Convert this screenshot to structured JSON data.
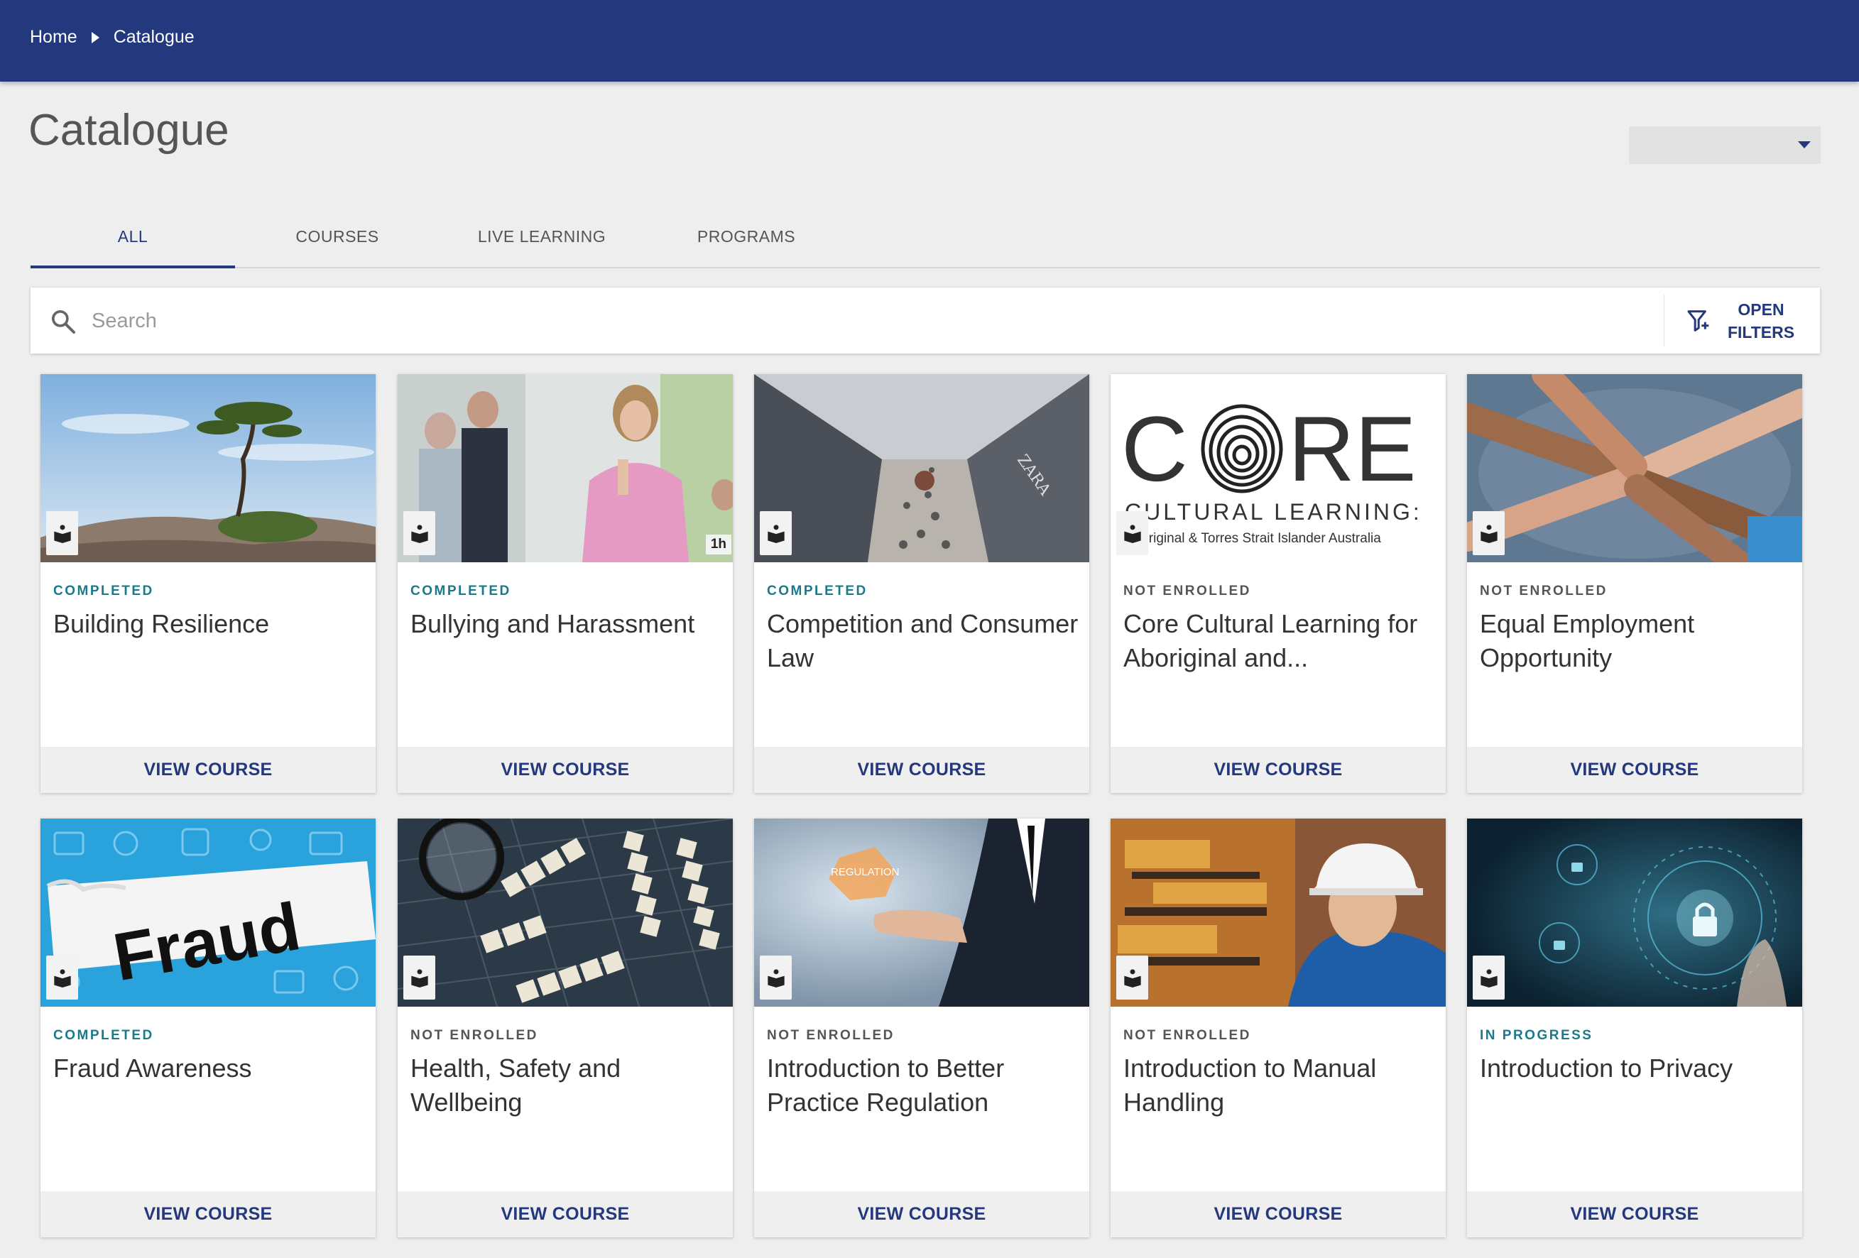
{
  "breadcrumb": {
    "home": "Home",
    "current": "Catalogue"
  },
  "page": {
    "title": "Catalogue"
  },
  "tabs": [
    {
      "label": "ALL"
    },
    {
      "label": "COURSES"
    },
    {
      "label": "LIVE LEARNING"
    },
    {
      "label": "PROGRAMS"
    }
  ],
  "search": {
    "placeholder": "Search",
    "filters_line1": "OPEN",
    "filters_line2": "FILTERS"
  },
  "colors": {
    "brand": "#24387e",
    "completed": "#1a7a8a",
    "muted": "#555555"
  },
  "cards": [
    {
      "status": "COMPLETED",
      "title": "Building Resilience",
      "action": "VIEW COURSE",
      "image": "tree-landscape",
      "duration": ""
    },
    {
      "status": "COMPLETED",
      "title": "Bullying and Harassment",
      "action": "VIEW COURSE",
      "image": "office-people",
      "duration": "1h"
    },
    {
      "status": "COMPLETED",
      "title": "Competition and Consumer Law",
      "action": "VIEW COURSE",
      "image": "shopping-mall",
      "duration": ""
    },
    {
      "status": "NOT ENROLLED",
      "title": "Core Cultural Learning for Aboriginal and...",
      "action": "VIEW COURSE",
      "image": "core-logo",
      "duration": "",
      "logo_word_left": "C",
      "logo_word_right": "RE",
      "logo_line1": "CULTURAL LEARNING:",
      "logo_line2": "Aboriginal & Torres Strait Islander Australia"
    },
    {
      "status": "NOT ENROLLED",
      "title": "Equal Employment Opportunity",
      "action": "VIEW COURSE",
      "image": "hands-stack",
      "duration": ""
    },
    {
      "status": "COMPLETED",
      "title": "Fraud Awareness",
      "action": "VIEW COURSE",
      "image": "fraud-paper",
      "duration": "",
      "image_word": "Fraud"
    },
    {
      "status": "NOT ENROLLED",
      "title": "Health, Safety and Wellbeing",
      "action": "VIEW COURSE",
      "image": "scrabble-tiles",
      "duration": ""
    },
    {
      "status": "NOT ENROLLED",
      "title": "Introduction to Better Practice Regulation",
      "action": "VIEW COURSE",
      "image": "regulation-hand",
      "duration": "",
      "image_word": "REGULATION"
    },
    {
      "status": "NOT ENROLLED",
      "title": "Introduction to Manual Handling",
      "action": "VIEW COURSE",
      "image": "hardhat-worker",
      "duration": ""
    },
    {
      "status": "IN PROGRESS",
      "title": "Introduction to Privacy",
      "action": "VIEW COURSE",
      "image": "digital-lock",
      "duration": ""
    }
  ]
}
